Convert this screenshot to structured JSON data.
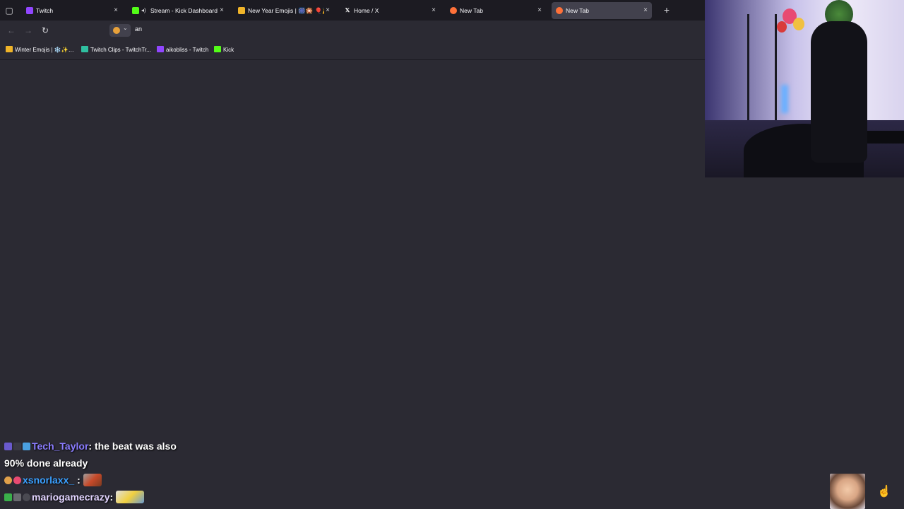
{
  "tabs": [
    {
      "title": "Twitch",
      "favicon": "twitch-icon",
      "color": "#9146ff",
      "active": false,
      "audio": false
    },
    {
      "title": "Stream - Kick Dashboard",
      "favicon": "kick-icon",
      "color": "#53fc18",
      "active": false,
      "audio": true
    },
    {
      "title": "New Year Emojis | 🎆🎇 🎈🎉 ✨",
      "favicon": "folder-icon",
      "color": "#f0b429",
      "active": false,
      "audio": false
    },
    {
      "title": "Home / X",
      "favicon": "x-icon",
      "color": "#ffffff",
      "active": false,
      "audio": false
    },
    {
      "title": "New Tab",
      "favicon": "firefox-icon",
      "color": "#ff7139",
      "active": false,
      "audio": false
    },
    {
      "title": "New Tab",
      "favicon": "firefox-icon",
      "color": "#ff7139",
      "active": true,
      "audio": false
    }
  ],
  "tab_glyphs": {
    "close": "×",
    "new": "+",
    "list": "▢",
    "audio": "◂)"
  },
  "nav": {
    "back": "←",
    "forward": "→",
    "reload": "↻"
  },
  "urlbar": {
    "text": "an",
    "chevron": "⌄"
  },
  "bookmarks": [
    {
      "label": "Winter Emojis | ❄️✨…",
      "icon": "folder-icon",
      "color": "#f0b429"
    },
    {
      "label": "Twitch Clips - TwitchTr...",
      "icon": "twitchtracker-icon",
      "color": "#2fbfa0"
    },
    {
      "label": "aikobliss - Twitch",
      "icon": "twitch-icon",
      "color": "#9146ff"
    },
    {
      "label": "Kick",
      "icon": "kick-icon",
      "color": "#53fc18"
    }
  ],
  "chat": [
    {
      "user": "Tech_Taylor",
      "message": "the beat was also"
    },
    {
      "user": "",
      "message": "90% done already"
    },
    {
      "user": "xsnorlaxx_",
      "message": ""
    },
    {
      "user": "mariogamecrazy",
      "message": ""
    }
  ],
  "chat_separator": ":",
  "colors": {
    "background": "#2b2a33",
    "tabstrip": "#1c1b22",
    "active_tab": "#42414d"
  }
}
